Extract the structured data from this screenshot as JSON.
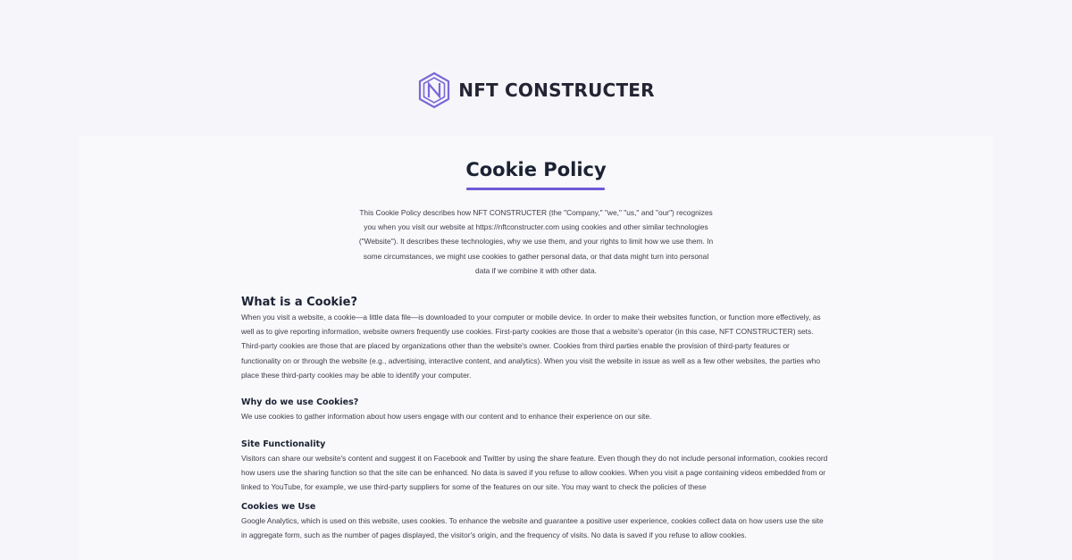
{
  "brand": {
    "name": "NFT CONSTRUCTER",
    "logo_icon": "hexagon-n-logo-icon",
    "accent_color": "#6e5ad6"
  },
  "page": {
    "title": "Cookie Policy",
    "intro": "This Cookie Policy describes how NFT CONSTRUCTER (the \"Company,\" \"we,\" \"us,\" and \"our\") recognizes you when you visit our website at https://nftconstructer.com using cookies and other similar technologies (\"Website\"). It describes these technologies, why we use them, and your rights to limit how we use them. In some circumstances, we might use cookies to gather personal data, or that data might turn into personal data if we combine it with other data."
  },
  "sections": [
    {
      "heading": "What is a Cookie?",
      "body": "When you visit a website, a cookie—a little data file—is downloaded to your computer or mobile device. In order to make their websites function, or function more effectively, as well as to give reporting information, website owners frequently use cookies. First-party cookies are those that a website's operator (in this case, NFT CONSTRUCTER) sets. Third-party cookies are those that are placed by organizations other than the website's owner. Cookies from third parties enable the provision of third-party features or functionality on or through the website (e.g., advertising, interactive content, and analytics). When you visit the website in issue as well as a few other websites, the parties who place these third-party cookies may be able to identify your computer."
    },
    {
      "heading": "Why do we use Cookies?",
      "body": "We use cookies to gather information about how users engage with our content and to enhance their experience on our site."
    },
    {
      "heading": "Site Functionality",
      "body": "Visitors can share our website's content and suggest it on Facebook and Twitter by using the share feature. Even though they do not include personal information, cookies record how users use the sharing function so that the site can be enhanced. No data is saved if you refuse to allow cookies. When you visit a page containing videos embedded from or linked to YouTube, for example, we use third-party suppliers for some of the features on our site. You may want to check the policies of these"
    },
    {
      "heading": "Cookies we Use",
      "body": " Google Analytics, which is used on this website, uses cookies. To enhance the website and guarantee a positive user experience, cookies collect data on how users use the site in aggregate form, such as the number of pages displayed, the visitor's origin, and the frequency of visits. No data is saved if you refuse to allow cookies."
    }
  ]
}
